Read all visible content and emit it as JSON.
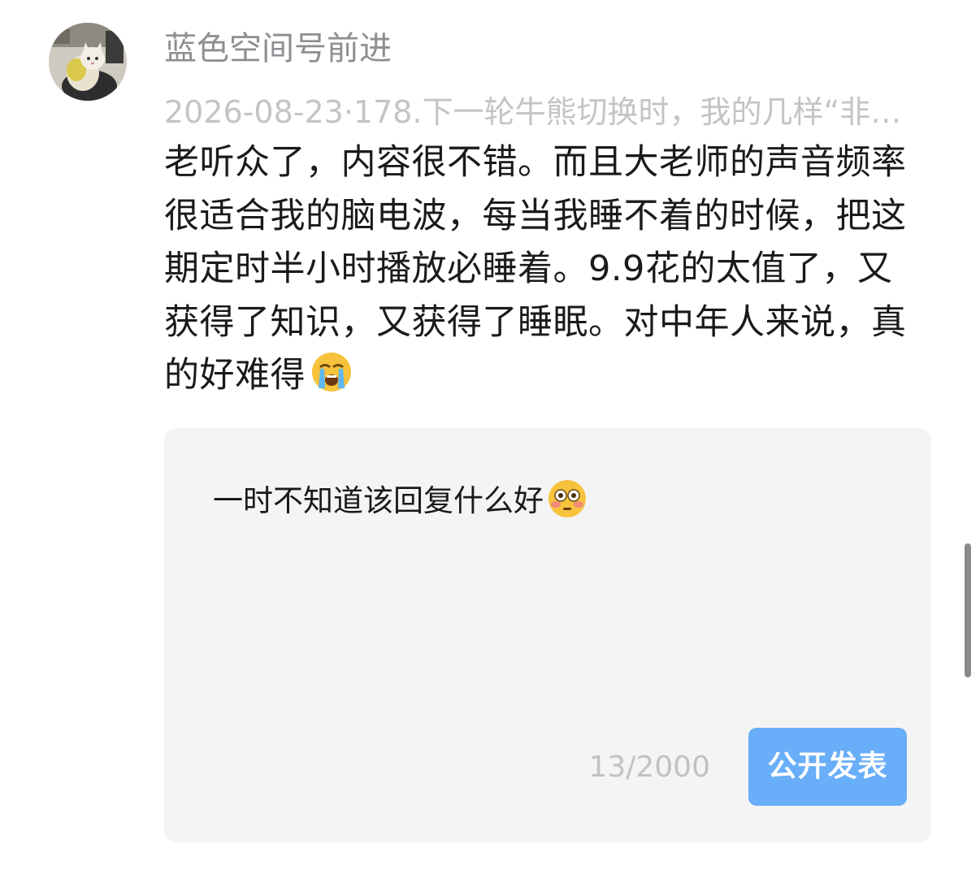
{
  "comment": {
    "username": "蓝色空间号前进",
    "quote": "2026-08-23·178.下一轮牛熊切换时，我的几样“非…",
    "body": "老听众了，内容很不错。而且大老师的声音频率很适合我的脑电波，每当我睡不着的时候，把这期定时半小时播放必睡着。9.9花的太值了，又获得了知识，又获得了睡眠。对中年人来说，真的好难得",
    "emoji": "loudly-crying-face"
  },
  "reply": {
    "text": "一时不知道该回复什么好",
    "emoji": "flushed-face",
    "counter": "13/2000",
    "publish_label": "公开发表",
    "button_color": "#68aef9"
  }
}
